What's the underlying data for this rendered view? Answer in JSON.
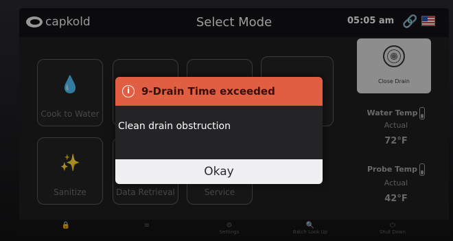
{
  "header": {
    "logo": "capkold",
    "title": "Select Mode",
    "time": "05:05 am"
  },
  "tiles": [
    {
      "label": "Cook to Water",
      "icon": "water-drop-icon"
    },
    {
      "label": "Sanitize",
      "icon": "sparkle-icon"
    },
    {
      "label": "Data Retrieval",
      "icon": "data-icon"
    },
    {
      "label": "Service",
      "icon": "service-icon"
    }
  ],
  "side": {
    "close_drain": "Close Drain",
    "water_temp": "Water Temp",
    "water_actual": "Actual",
    "water_value": "72°F",
    "probe_temp": "Probe Temp",
    "probe_actual": "Actual",
    "probe_value": "42°F"
  },
  "footer": {
    "settings": "Settings",
    "batch": "Batch Look Up",
    "shutdown": "Shut Down"
  },
  "modal": {
    "title": "9-Drain Time exceeded",
    "message": "Clean drain obstruction",
    "button": "Okay"
  },
  "colors": {
    "alert": "#e05f43",
    "background": "#1e1e20",
    "link_icon": "#8fd13b"
  }
}
